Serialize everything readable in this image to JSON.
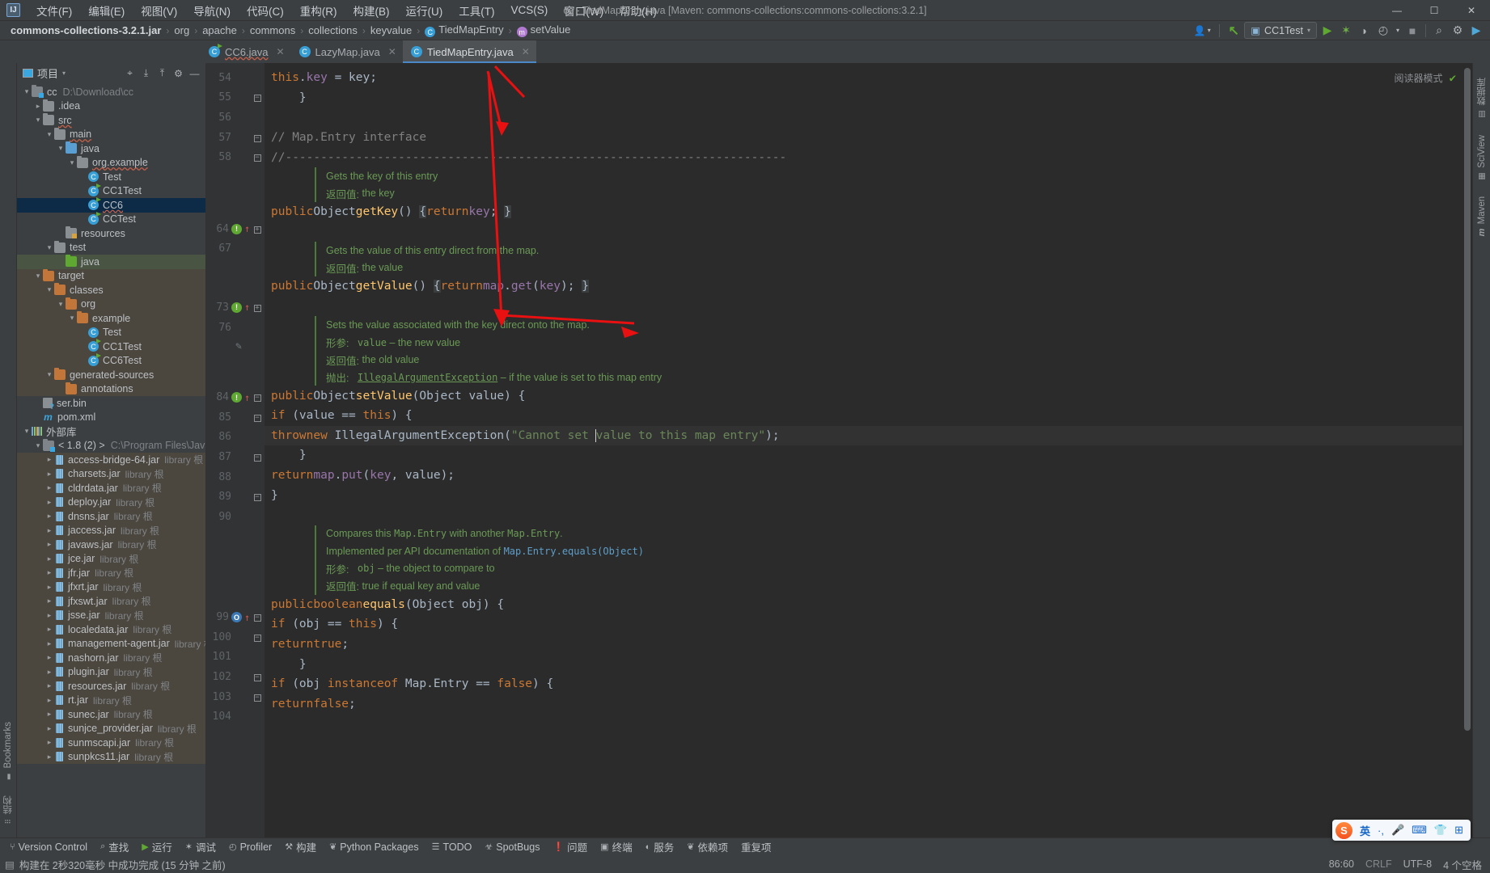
{
  "window": {
    "title": "cc - TiedMapEntry.java [Maven: commons-collections:commons-collections:3.2.1]",
    "logo": "IJ",
    "minimize": "—",
    "maximize": "☐",
    "close": "✕"
  },
  "menu": [
    {
      "label": "文件(F)",
      "name": "menu-file"
    },
    {
      "label": "编辑(E)",
      "name": "menu-edit"
    },
    {
      "label": "视图(V)",
      "name": "menu-view"
    },
    {
      "label": "导航(N)",
      "name": "menu-navigate"
    },
    {
      "label": "代码(C)",
      "name": "menu-code"
    },
    {
      "label": "重构(R)",
      "name": "menu-refactor"
    },
    {
      "label": "构建(B)",
      "name": "menu-build"
    },
    {
      "label": "运行(U)",
      "name": "menu-run"
    },
    {
      "label": "工具(T)",
      "name": "menu-tools"
    },
    {
      "label": "VCS(S)",
      "name": "menu-vcs"
    },
    {
      "label": "窗口(W)",
      "name": "menu-window"
    },
    {
      "label": "帮助(H)",
      "name": "menu-help"
    }
  ],
  "breadcrumbs": [
    {
      "label": "commons-collections-3.2.1.jar",
      "icon": "",
      "bold": true
    },
    {
      "label": "org",
      "icon": ""
    },
    {
      "label": "apache",
      "icon": ""
    },
    {
      "label": "commons",
      "icon": ""
    },
    {
      "label": "collections",
      "icon": ""
    },
    {
      "label": "keyvalue",
      "icon": ""
    },
    {
      "label": "TiedMapEntry",
      "icon": "class"
    },
    {
      "label": "setValue",
      "icon": "method"
    }
  ],
  "toolbar": {
    "run_config": "CC1Test",
    "run_config_icon": "▣",
    "dropdown_caret": "▾",
    "buttons": [
      {
        "name": "run-button",
        "glyph": "▶",
        "color": "#5fa832"
      },
      {
        "name": "debug-button",
        "glyph": "✶",
        "color": "#6fb04a"
      },
      {
        "name": "run-with-coverage-button",
        "glyph": "◗",
        "color": "#b0b4b8"
      },
      {
        "name": "profile-button",
        "glyph": "◴",
        "color": "#b0b4b8"
      },
      {
        "name": "stop-button",
        "glyph": "■",
        "color": "#8b8f93"
      },
      {
        "name": "search-everywhere-button",
        "glyph": "⌕",
        "color": "#b0b4b8"
      },
      {
        "name": "settings-button",
        "glyph": "⚙",
        "color": "#b0b4b8"
      },
      {
        "name": "ai-assistant-button",
        "glyph": "▶",
        "color": "#4fa8d8"
      }
    ],
    "user_icon": "👤",
    "updates_icon": "↖"
  },
  "tabs": [
    {
      "label": "CC6.java",
      "icon": "class-run",
      "active": false,
      "spell": true
    },
    {
      "label": "LazyMap.java",
      "icon": "class",
      "active": false,
      "spell": false
    },
    {
      "label": "TiedMapEntry.java",
      "icon": "class",
      "active": true,
      "spell": false
    }
  ],
  "project_panel": {
    "title": "项目",
    "dropdown": "▾",
    "tools": [
      {
        "name": "locate-file-icon",
        "glyph": "⌖"
      },
      {
        "name": "expand-all-icon",
        "glyph": "⤓"
      },
      {
        "name": "collapse-all-icon",
        "glyph": "⤒"
      },
      {
        "name": "settings-icon",
        "glyph": "⚙"
      },
      {
        "name": "hide-icon",
        "glyph": "—"
      }
    ],
    "tree": [
      {
        "indent": 0,
        "arrow": "⌄",
        "icon": "module",
        "label": "cc",
        "tag": "D:\\Download\\cc",
        "kind": "module"
      },
      {
        "indent": 1,
        "arrow": "›",
        "icon": "folder",
        "label": ".idea",
        "kind": "folder"
      },
      {
        "indent": 1,
        "arrow": "⌄",
        "icon": "folder",
        "label": "src",
        "kind": "folder",
        "spell": true
      },
      {
        "indent": 2,
        "arrow": "⌄",
        "icon": "folder",
        "label": "main",
        "kind": "folder",
        "spell": true
      },
      {
        "indent": 3,
        "arrow": "⌄",
        "icon": "folder-blue",
        "label": "java",
        "kind": "folder"
      },
      {
        "indent": 4,
        "arrow": "⌄",
        "icon": "package",
        "label": "org.example",
        "kind": "package",
        "spell": true
      },
      {
        "indent": 5,
        "arrow": "",
        "icon": "class",
        "label": "Test",
        "kind": "class"
      },
      {
        "indent": 5,
        "arrow": "",
        "icon": "class-run",
        "label": "CC1Test",
        "kind": "class"
      },
      {
        "indent": 5,
        "arrow": "",
        "icon": "class-run",
        "label": "CC6",
        "kind": "class",
        "selected": "blue",
        "spell": true
      },
      {
        "indent": 5,
        "arrow": "",
        "icon": "class-run",
        "label": "CCTest",
        "kind": "class"
      },
      {
        "indent": 3,
        "arrow": "",
        "icon": "folder-res",
        "label": "resources",
        "kind": "folder"
      },
      {
        "indent": 2,
        "arrow": "⌄",
        "icon": "folder",
        "label": "test",
        "kind": "folder"
      },
      {
        "indent": 3,
        "arrow": "",
        "icon": "folder-green",
        "label": "java",
        "kind": "folder",
        "selected": "green"
      },
      {
        "indent": 1,
        "arrow": "⌄",
        "icon": "folder-orange",
        "label": "target",
        "kind": "folder",
        "shade": true
      },
      {
        "indent": 2,
        "arrow": "⌄",
        "icon": "folder-orange",
        "label": "classes",
        "kind": "folder",
        "shade": true
      },
      {
        "indent": 3,
        "arrow": "⌄",
        "icon": "folder-orange",
        "label": "org",
        "kind": "folder",
        "shade": true
      },
      {
        "indent": 4,
        "arrow": "⌄",
        "icon": "folder-orange",
        "label": "example",
        "kind": "folder",
        "shade": true
      },
      {
        "indent": 5,
        "arrow": "",
        "icon": "class",
        "label": "Test",
        "kind": "class",
        "shade": true
      },
      {
        "indent": 5,
        "arrow": "",
        "icon": "class-run",
        "label": "CC1Test",
        "kind": "class",
        "shade": true
      },
      {
        "indent": 5,
        "arrow": "",
        "icon": "class-run",
        "label": "CC6Test",
        "kind": "class",
        "shade": true
      },
      {
        "indent": 2,
        "arrow": "⌄",
        "icon": "folder-orange",
        "label": "generated-sources",
        "kind": "folder",
        "shade": true
      },
      {
        "indent": 3,
        "arrow": "",
        "icon": "folder-orange",
        "label": "annotations",
        "kind": "folder",
        "shade": true
      },
      {
        "indent": 1,
        "arrow": "",
        "icon": "bin",
        "label": "ser.bin",
        "kind": "file"
      },
      {
        "indent": 1,
        "arrow": "",
        "icon": "maven",
        "label": "pom.xml",
        "kind": "file"
      },
      {
        "indent": 0,
        "arrow": "⌄",
        "icon": "extlib",
        "label": "外部库",
        "kind": "group"
      },
      {
        "indent": 1,
        "arrow": "⌄",
        "icon": "jdk",
        "label": "< 1.8 (2) >",
        "tag": "C:\\Program Files\\Java\\jdk",
        "kind": "jdk"
      },
      {
        "indent": 2,
        "arrow": "›",
        "icon": "jar",
        "label": "access-bridge-64.jar",
        "tag": "library 根",
        "kind": "jar",
        "shade": true
      },
      {
        "indent": 2,
        "arrow": "›",
        "icon": "jar",
        "label": "charsets.jar",
        "tag": "library 根",
        "kind": "jar",
        "shade": true
      },
      {
        "indent": 2,
        "arrow": "›",
        "icon": "jar",
        "label": "cldrdata.jar",
        "tag": "library 根",
        "kind": "jar",
        "shade": true
      },
      {
        "indent": 2,
        "arrow": "›",
        "icon": "jar",
        "label": "deploy.jar",
        "tag": "library 根",
        "kind": "jar",
        "shade": true
      },
      {
        "indent": 2,
        "arrow": "›",
        "icon": "jar",
        "label": "dnsns.jar",
        "tag": "library 根",
        "kind": "jar",
        "shade": true
      },
      {
        "indent": 2,
        "arrow": "›",
        "icon": "jar",
        "label": "jaccess.jar",
        "tag": "library 根",
        "kind": "jar",
        "shade": true
      },
      {
        "indent": 2,
        "arrow": "›",
        "icon": "jar",
        "label": "javaws.jar",
        "tag": "library 根",
        "kind": "jar",
        "shade": true
      },
      {
        "indent": 2,
        "arrow": "›",
        "icon": "jar",
        "label": "jce.jar",
        "tag": "library 根",
        "kind": "jar",
        "shade": true
      },
      {
        "indent": 2,
        "arrow": "›",
        "icon": "jar",
        "label": "jfr.jar",
        "tag": "library 根",
        "kind": "jar",
        "shade": true
      },
      {
        "indent": 2,
        "arrow": "›",
        "icon": "jar",
        "label": "jfxrt.jar",
        "tag": "library 根",
        "kind": "jar",
        "shade": true
      },
      {
        "indent": 2,
        "arrow": "›",
        "icon": "jar",
        "label": "jfxswt.jar",
        "tag": "library 根",
        "kind": "jar",
        "shade": true
      },
      {
        "indent": 2,
        "arrow": "›",
        "icon": "jar",
        "label": "jsse.jar",
        "tag": "library 根",
        "kind": "jar",
        "shade": true
      },
      {
        "indent": 2,
        "arrow": "›",
        "icon": "jar",
        "label": "localedata.jar",
        "tag": "library 根",
        "kind": "jar",
        "shade": true
      },
      {
        "indent": 2,
        "arrow": "›",
        "icon": "jar",
        "label": "management-agent.jar",
        "tag": "library 根",
        "kind": "jar",
        "shade": true
      },
      {
        "indent": 2,
        "arrow": "›",
        "icon": "jar",
        "label": "nashorn.jar",
        "tag": "library 根",
        "kind": "jar",
        "shade": true
      },
      {
        "indent": 2,
        "arrow": "›",
        "icon": "jar",
        "label": "plugin.jar",
        "tag": "library 根",
        "kind": "jar",
        "shade": true
      },
      {
        "indent": 2,
        "arrow": "›",
        "icon": "jar",
        "label": "resources.jar",
        "tag": "library 根",
        "kind": "jar",
        "shade": true
      },
      {
        "indent": 2,
        "arrow": "›",
        "icon": "jar",
        "label": "rt.jar",
        "tag": "library 根",
        "kind": "jar",
        "shade": true
      },
      {
        "indent": 2,
        "arrow": "›",
        "icon": "jar",
        "label": "sunec.jar",
        "tag": "library 根",
        "kind": "jar",
        "shade": true
      },
      {
        "indent": 2,
        "arrow": "›",
        "icon": "jar",
        "label": "sunjce_provider.jar",
        "tag": "library 根",
        "kind": "jar",
        "shade": true
      },
      {
        "indent": 2,
        "arrow": "›",
        "icon": "jar",
        "label": "sunmscapi.jar",
        "tag": "library 根",
        "kind": "jar",
        "shade": true
      },
      {
        "indent": 2,
        "arrow": "›",
        "icon": "jar",
        "label": "sunpkcs11.jar",
        "tag": "library 根",
        "kind": "jar",
        "shade": true
      }
    ]
  },
  "left_strip": [
    {
      "label": "Bookmarks",
      "name": "bookmarks-tool-button",
      "icon": "▮"
    },
    {
      "label": "结构",
      "name": "structure-tool-button",
      "icon": "█"
    }
  ],
  "right_strip": [
    {
      "label": "数据库",
      "name": "database-tool-button",
      "icon": "▤"
    },
    {
      "label": "SciView",
      "name": "sciview-tool-button",
      "icon": "☷"
    },
    {
      "label": "Maven",
      "name": "maven-tool-button",
      "icon": "m"
    }
  ],
  "editor": {
    "reader_mode": "阅读器模式",
    "inspection_ok": "✔",
    "lines": [
      {
        "num": "54",
        "fold": "",
        "mark": "",
        "type": "code"
      },
      {
        "num": "55",
        "fold": "−",
        "mark": "",
        "type": "code"
      },
      {
        "num": "56",
        "fold": "",
        "mark": "",
        "type": "code"
      },
      {
        "num": "57",
        "fold": "−",
        "mark": "",
        "type": "code"
      },
      {
        "num": "58",
        "fold": "−",
        "mark": "",
        "type": "code"
      },
      {
        "num": "64",
        "fold": "+",
        "mark": "green",
        "type": "code"
      },
      {
        "num": "67",
        "fold": "",
        "mark": "",
        "type": "code"
      },
      {
        "num": "73",
        "fold": "+",
        "mark": "green",
        "type": "code"
      },
      {
        "num": "76",
        "fold": "",
        "mark": "",
        "type": "code"
      },
      {
        "num": "84",
        "fold": "−",
        "mark": "green",
        "type": "code"
      },
      {
        "num": "85",
        "fold": "−",
        "mark": "",
        "type": "code"
      },
      {
        "num": "86",
        "fold": "",
        "mark": "",
        "type": "code"
      },
      {
        "num": "87",
        "fold": "−",
        "mark": "",
        "type": "code"
      },
      {
        "num": "88",
        "fold": "",
        "mark": "",
        "type": "code"
      },
      {
        "num": "89",
        "fold": "−",
        "mark": "",
        "type": "code"
      },
      {
        "num": "90",
        "fold": "",
        "mark": "",
        "type": "code"
      },
      {
        "num": "99",
        "fold": "−",
        "mark": "blue",
        "type": "code"
      },
      {
        "num": "100",
        "fold": "−",
        "mark": "",
        "type": "code"
      },
      {
        "num": "101",
        "fold": "",
        "mark": "",
        "type": "code"
      },
      {
        "num": "102",
        "fold": "−",
        "mark": "",
        "type": "code"
      },
      {
        "num": "103",
        "fold": "−",
        "mark": "",
        "type": "code"
      },
      {
        "num": "104",
        "fold": "",
        "mark": "",
        "type": "code"
      }
    ],
    "code_text": {
      "l54": "        this.key = key;",
      "l55": "    }",
      "l57": "    // Map.Entry interface",
      "l58": "    //-----------------------------------------------------------------------",
      "doc1_a": "Gets the key of this entry",
      "doc1_b_key": "返回值:",
      "doc1_b_val": "the key",
      "l64": "public Object getKey() { return key; }",
      "doc2_a": "Gets the value of this entry direct from the map.",
      "doc2_b_key": "返回值:",
      "doc2_b_val": "the value",
      "l73": "public Object getValue() { return map.get(key); }",
      "doc3_a": "Sets the value associated with the key direct onto the map.",
      "doc3_param_key": "形参:",
      "doc3_param_name": "value",
      "doc3_param_desc": "– the new value",
      "doc3_ret_key": "返回值:",
      "doc3_ret_val": "the old value",
      "doc3_throw_key": "抛出:",
      "doc3_throw_type": "IllegalArgumentException",
      "doc3_throw_desc": "– if the value is set to this map entry",
      "l84": "public Object setValue(Object value) {",
      "l85": "    if (value == this) {",
      "l86_a": "        throw new IllegalArgumentException(",
      "l86_str1": "\"Cannot set ",
      "l86_str2": "value to this map entry\"",
      "l86_b": ");",
      "l87": "    }",
      "l88": "    return map.put(key, value);",
      "l89": "}",
      "doc4_a1": "Compares this ",
      "doc4_a2": "Map.Entry",
      "doc4_a3": " with another ",
      "doc4_a4": "Map.Entry",
      "doc4_a5": ".",
      "doc4_b1": "Implemented per API documentation of ",
      "doc4_b2": "Map.Entry.equals(Object)",
      "doc4_param_key": "形参:",
      "doc4_param_name": "obj",
      "doc4_param_desc": "– the object to compare to",
      "doc4_ret_key": "返回值:",
      "doc4_ret_val": "true if equal key and value",
      "l99": "public boolean equals(Object obj) {",
      "l100": "    if (obj == this) {",
      "l101": "        return true;",
      "l102": "    }",
      "l103": "    if (obj instanceof Map.Entry == false) {",
      "l104": "        return false;"
    }
  },
  "bottom_tools": [
    {
      "label": "Version Control",
      "icon": "⑂",
      "name": "version-control-button"
    },
    {
      "label": "查找",
      "icon": "⌕",
      "name": "find-button"
    },
    {
      "label": "运行",
      "icon": "▶",
      "name": "run-tool-button"
    },
    {
      "label": "调试",
      "icon": "✶",
      "name": "debug-tool-button"
    },
    {
      "label": "Profiler",
      "icon": "◴",
      "name": "profiler-tool-button"
    },
    {
      "label": "构建",
      "icon": "⚒",
      "name": "build-tool-button"
    },
    {
      "label": "Python Packages",
      "icon": "❦",
      "name": "python-packages-button"
    },
    {
      "label": "TODO",
      "icon": "☰",
      "name": "todo-button"
    },
    {
      "label": "SpotBugs",
      "icon": "☣",
      "name": "spotbugs-button"
    },
    {
      "label": "问题",
      "icon": "❗",
      "name": "problems-button"
    },
    {
      "label": "终端",
      "icon": "▣",
      "name": "terminal-button"
    },
    {
      "label": "服务",
      "icon": "◐",
      "name": "services-button"
    },
    {
      "label": "依赖项",
      "icon": "❦",
      "name": "dependencies-button"
    },
    {
      "label": "重复项",
      "icon": "",
      "name": "duplicates-button"
    }
  ],
  "status": {
    "icon": "▤",
    "message": "构建在 2秒320毫秒 中成功完成 (15 分钟 之前)",
    "caret_position": "86:60",
    "line_separator": "CRLF",
    "encoding": "UTF-8",
    "indent": "4 个空格"
  },
  "ime": {
    "logo": "S",
    "mode": "英",
    "punct": "·,",
    "mic": "🎙",
    "keyboard": "⌨",
    "skin": "👕",
    "apps": "⊞"
  },
  "colors": {
    "accent": "#4a88c7",
    "selection_blue": "#0d2b47",
    "selection_green": "#4a5443",
    "annotation_red": "#e81010",
    "editor_bg": "#2b2b2b",
    "panel_bg": "#3c3f41"
  }
}
